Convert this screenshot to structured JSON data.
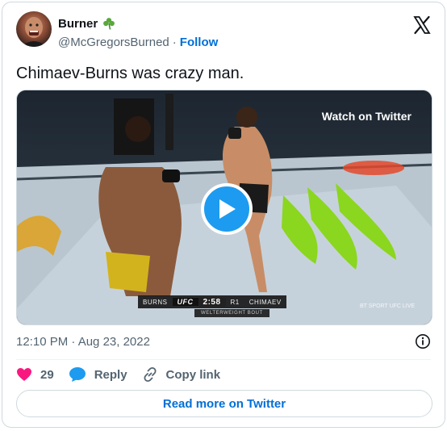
{
  "author": {
    "name": "Burner",
    "badge_icon": "shamrock-icon",
    "handle": "@McGregorsBurned",
    "separator": "·",
    "follow_label": "Follow"
  },
  "tweet": {
    "text": "Chimaev-Burns was crazy man."
  },
  "media": {
    "watch_label": "Watch on Twitter",
    "scorebug": {
      "fighter_left": "BURNS",
      "league": "UFC",
      "clock": "2:58",
      "round": "R1",
      "fighter_right": "CHIMAEV",
      "division": "WELTERWEIGHT BOUT"
    },
    "broadcaster": "BT SPORT  UFC LIVE"
  },
  "meta": {
    "timestamp": "12:10 PM · Aug 23, 2022"
  },
  "actions": {
    "like_count": "29",
    "reply_label": "Reply",
    "copy_label": "Copy link"
  },
  "read_more_label": "Read more on Twitter",
  "colors": {
    "link": "#006fd6",
    "like": "#f91880",
    "reply": "#1d9bf0",
    "play": "#1d9bf0",
    "muted": "#536471"
  }
}
